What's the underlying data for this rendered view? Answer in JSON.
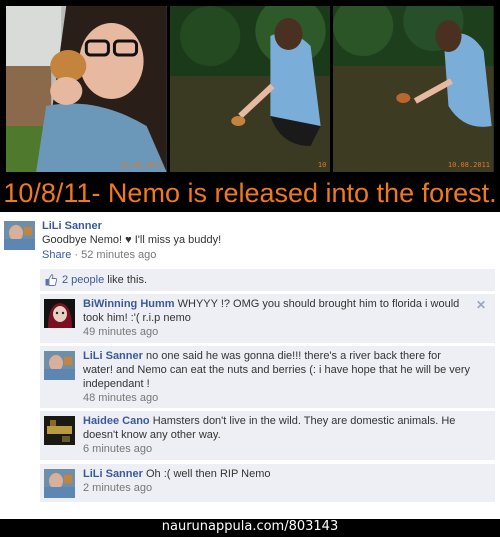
{
  "caption": "10/8/11- Nemo is released into the forest.",
  "photo_stamps": [
    "10.08.2011",
    "10",
    "10.08.2011"
  ],
  "post": {
    "author": "LiLi Sanner",
    "text": "Goodbye Nemo! ♥ I'll miss ya buddy!",
    "share_label": "Share",
    "separator": " · ",
    "time": "52 minutes ago"
  },
  "likes": {
    "count_label": "2 people",
    "suffix": " like this."
  },
  "comments": [
    {
      "author": "BiWinning Humm",
      "text": "WHYYY !? OMG you should brought him to florida i would took him! :'( r.i.p nemo",
      "time": "49 minutes ago",
      "avatar_icon": "avatar-icon"
    },
    {
      "author": "LiLi Sanner",
      "text": "no one said he was gonna die!!! there's a river back there for water! and Nemo can eat the nuts and berries (: i have hope that he will be very independant !",
      "time": "48 minutes ago",
      "avatar_icon": "avatar-icon"
    },
    {
      "author": "Haidee Cano",
      "text": "Hamsters don't live in the wild. They are domestic animals. He doesn't know any other way.",
      "time": "6 minutes ago",
      "avatar_icon": "avatar-icon"
    },
    {
      "author": "LiLi Sanner",
      "text": "Oh :( well then RIP Nemo",
      "time": "2 minutes ago",
      "avatar_icon": "avatar-icon"
    }
  ],
  "footer": "naurunappula.com/803143",
  "colors": {
    "caption": "#f07820",
    "link": "#3b5998",
    "comment_bg": "#edeff4"
  }
}
